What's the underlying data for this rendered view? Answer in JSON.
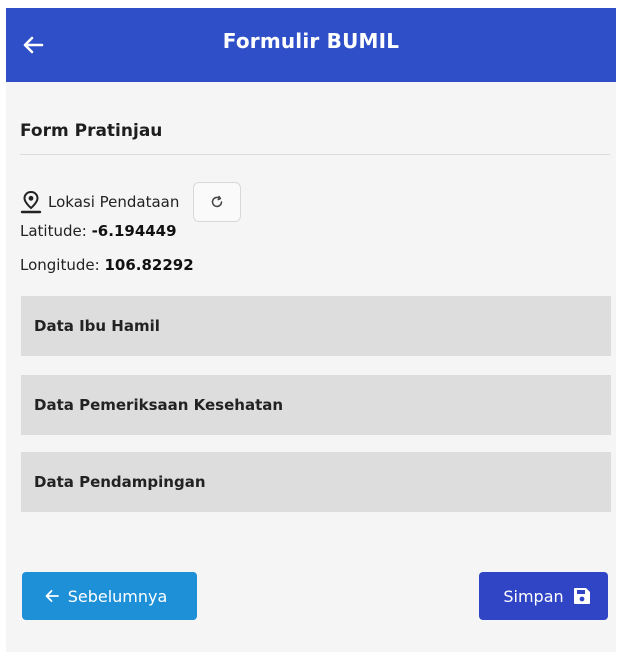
{
  "header": {
    "title": "Formulir BUMIL",
    "back_icon": "arrow-left-icon",
    "color": "#2f4fc8"
  },
  "form": {
    "section_title": "Form Pratinjau",
    "location": {
      "label": "Lokasi Pendataan",
      "icon": "map-pin-icon",
      "refresh_icon": "refresh-icon",
      "latitude_label": "Latitude:",
      "latitude_value": "-6.194449",
      "longitude_label": "Longitude:",
      "longitude_value": "106.82292"
    },
    "sections": [
      {
        "label": "Data Ibu Hamil"
      },
      {
        "label": "Data Pemeriksaan Kesehatan"
      },
      {
        "label": "Data Pendampingan"
      }
    ]
  },
  "actions": {
    "previous_label": "Sebelumnya",
    "previous_color": "#1e90d8",
    "save_label": "Simpan",
    "save_icon": "save-icon",
    "save_color": "#2f45c6"
  }
}
